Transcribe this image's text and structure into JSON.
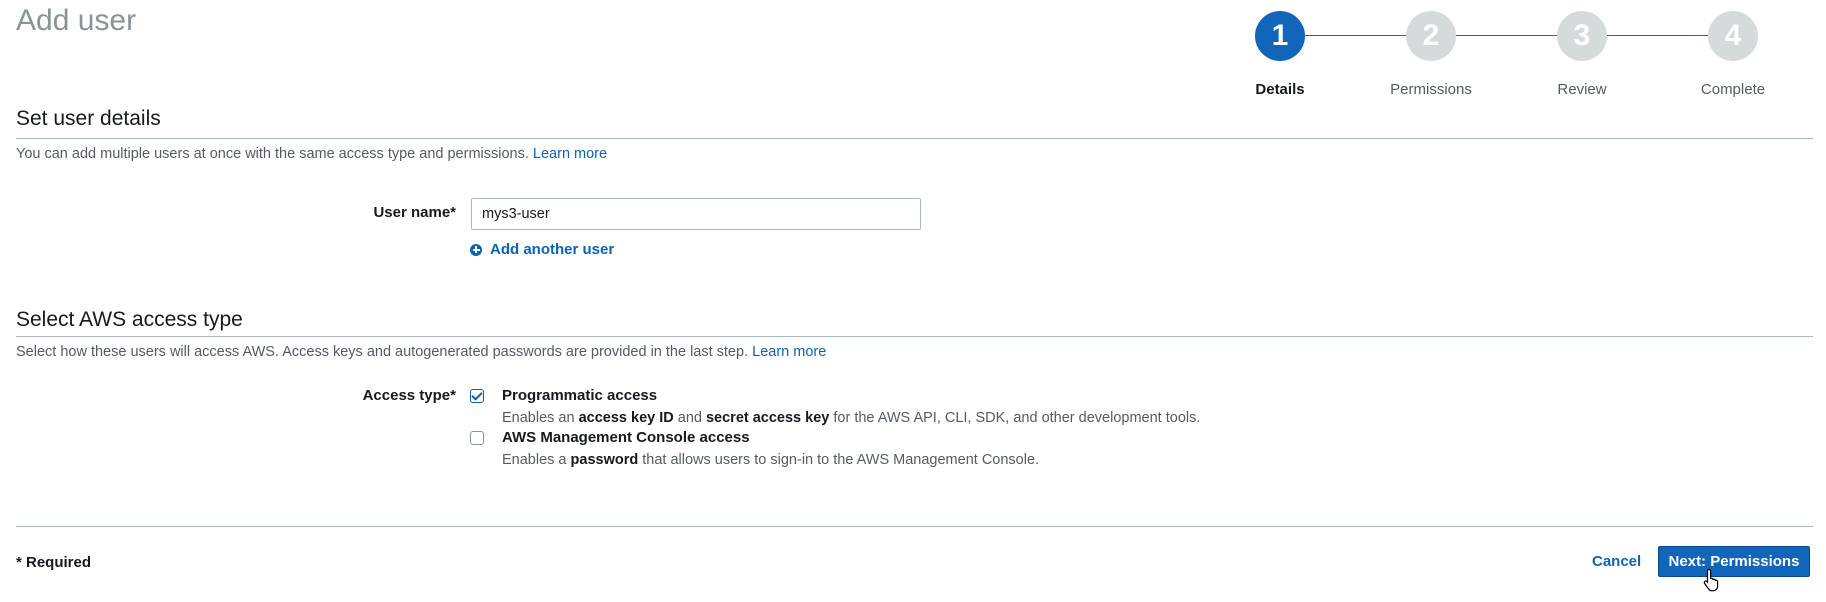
{
  "page": {
    "title": "Add user"
  },
  "stepper": {
    "steps": [
      {
        "number": "1",
        "label": "Details"
      },
      {
        "number": "2",
        "label": "Permissions"
      },
      {
        "number": "3",
        "label": "Review"
      },
      {
        "number": "4",
        "label": "Complete"
      }
    ],
    "active_step": "1"
  },
  "user_details": {
    "title": "Set user details",
    "description": "You can add multiple users at once with the same access type and permissions.",
    "learn_more": "Learn more",
    "user_name_label": "User name*",
    "user_name_value": "mys3-user",
    "add_another_user": "Add another user"
  },
  "access_type": {
    "title": "Select AWS access type",
    "description": "Select how these users will access AWS. Access keys and autogenerated passwords are provided in the last step.",
    "learn_more": "Learn more",
    "label": "Access type*",
    "options": [
      {
        "title": "Programmatic access",
        "checked": true,
        "desc_parts": [
          "Enables an ",
          "access key ID",
          " and ",
          "secret access key",
          " for the AWS API, CLI, SDK, and other development tools."
        ]
      },
      {
        "title": "AWS Management Console access",
        "checked": false,
        "desc_parts": [
          "Enables a ",
          "password",
          " that allows users to sign-in to the AWS Management Console."
        ]
      }
    ]
  },
  "footer": {
    "required_note": "* Required",
    "cancel": "Cancel",
    "next": "Next: Permissions"
  },
  "colors": {
    "primary": "#1166bb",
    "link": "#0b63b6",
    "inactive_step": "#d5dbdb"
  }
}
